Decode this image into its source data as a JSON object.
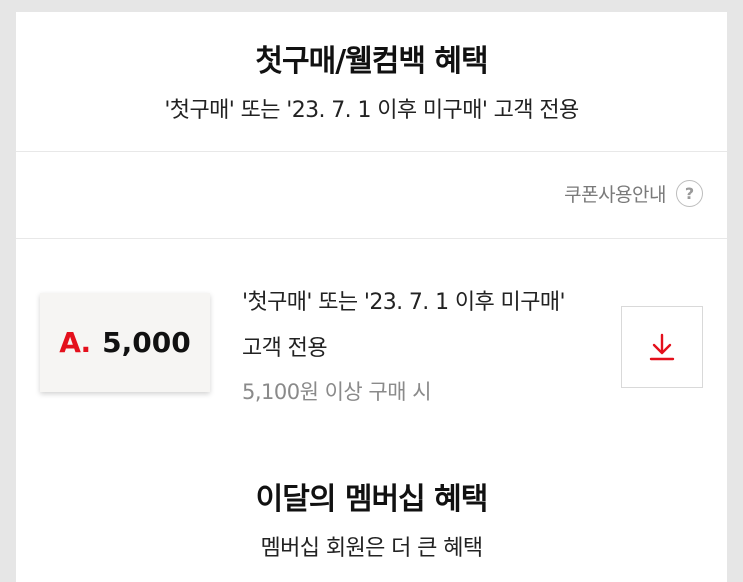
{
  "header": {
    "title": "첫구매/웰컴백 혜택",
    "subtitle": "'첫구매' 또는 '23. 7. 1 이후 미구매' 고객 전용"
  },
  "guide": {
    "label": "쿠폰사용안내",
    "help_glyph": "?"
  },
  "coupon": {
    "brand_mark": "A.",
    "amount": "5,000",
    "desc_line1": "'첫구매' 또는 '23. 7. 1 이후 미구매'",
    "desc_line2": "고객 전용",
    "condition": "5,100원 이상 구매 시",
    "download_icon": "download-icon",
    "accent_color": "#e4101c"
  },
  "membership": {
    "title": "이달의 멤버십 혜택",
    "subtitle": "멤버십 회원은 더 큰 혜택"
  }
}
